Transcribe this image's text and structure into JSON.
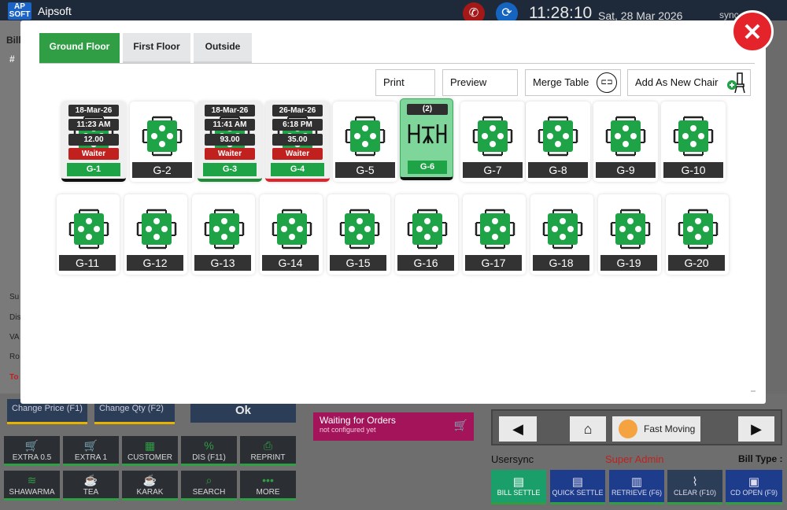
{
  "app": {
    "title": "Aipsoft",
    "logo": "AP SOFT",
    "time": "11:28:10",
    "date": "Sat, 28 Mar 2026",
    "sync_user": "sync"
  },
  "background": {
    "left_labels": [
      "Bill",
      "#",
      "Su",
      "Dis",
      "VA",
      "Ro",
      "To"
    ],
    "price_buttons": [
      "Change Price (F1)",
      "Change Qty (F2)"
    ],
    "ok_label": "Ok",
    "waiting": {
      "title": "Waiting for Orders",
      "subtitle": "not configured yet"
    },
    "fast_moving": "Fast Moving",
    "quick_buttons": [
      {
        "label": "EXTRA 0.5",
        "icon": "cart-icon"
      },
      {
        "label": "EXTRA 1",
        "icon": "cart-icon"
      },
      {
        "label": "CUSTOMER",
        "icon": "customer-icon"
      },
      {
        "label": "DIS (F11)",
        "icon": "percent-icon"
      },
      {
        "label": "REPRINT",
        "icon": "printer-icon"
      },
      {
        "label": "SHAWARMA",
        "icon": "food-icon"
      },
      {
        "label": "TEA",
        "icon": "cup-icon"
      },
      {
        "label": "KARAK",
        "icon": "cup-icon"
      },
      {
        "label": "SEARCH",
        "icon": "search-icon"
      },
      {
        "label": "MORE",
        "icon": "more-icon"
      }
    ],
    "user_label": "User",
    "user_name": "sync",
    "role": "Super Admin",
    "bill_type_label": "Bill Type :",
    "settle_buttons": [
      "BILL SETTLE",
      "QUICK SETTLE",
      "RETRIEVE (F6)",
      "CLEAR (F10)",
      "CD OPEN (F9)"
    ]
  },
  "modal": {
    "tabs": [
      "Ground Floor",
      "First Floor",
      "Outside"
    ],
    "active_tab": "Ground Floor",
    "actions": [
      "Print",
      "Preview",
      "Merge Table",
      "Add As New Chair"
    ],
    "tables_row1": [
      {
        "name": "G-1",
        "state": "busy",
        "date": "18-Mar-26",
        "time": "11:23 AM",
        "amount": "12.00",
        "waiter": "Waiter",
        "status_color": "#111111"
      },
      {
        "name": "G-2",
        "state": "free"
      },
      {
        "name": "G-3",
        "state": "busy",
        "date": "18-Mar-26",
        "time": "11:41 AM",
        "amount": "93.00",
        "waiter": "Waiter",
        "status_color": "#1f8c37"
      },
      {
        "name": "G-4",
        "state": "busy",
        "date": "26-Mar-26",
        "time": "6:18 PM",
        "amount": "35.00",
        "waiter": "Waiter",
        "status_color": "#e2232a"
      },
      {
        "name": "G-5",
        "state": "free"
      },
      {
        "name": "G-6",
        "state": "merged",
        "count": "(2)"
      },
      {
        "name": "G-7",
        "state": "free"
      },
      {
        "name": "G-8",
        "state": "free"
      },
      {
        "name": "G-9",
        "state": "free"
      },
      {
        "name": "G-10",
        "state": "free"
      }
    ],
    "tables_row2": [
      {
        "name": "G-11"
      },
      {
        "name": "G-12"
      },
      {
        "name": "G-13"
      },
      {
        "name": "G-14"
      },
      {
        "name": "G-15"
      },
      {
        "name": "G-16"
      },
      {
        "name": "G-17"
      },
      {
        "name": "G-18"
      },
      {
        "name": "G-19"
      },
      {
        "name": "G-20"
      }
    ]
  },
  "colors": {
    "accent_green": "#2f9e44",
    "close_red": "#e4232a",
    "waiter_red": "#c0211f"
  }
}
